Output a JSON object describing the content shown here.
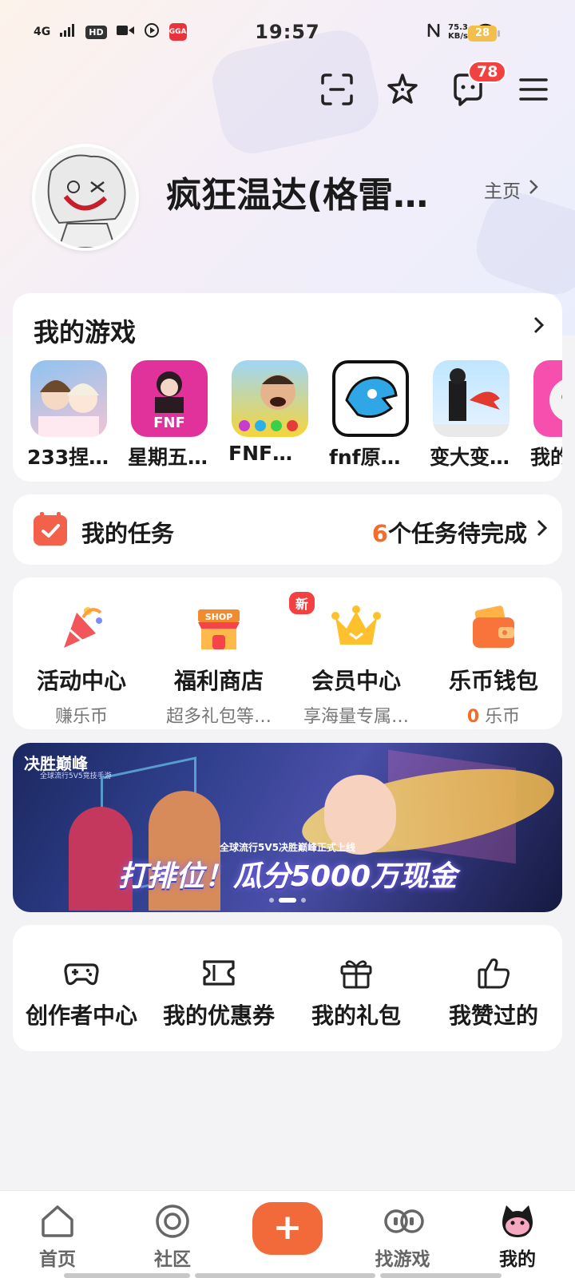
{
  "status_bar": {
    "signal": "4G",
    "hd": "HD",
    "app_badge": "GGA",
    "time": "19:57",
    "net_speed_value": "75.3",
    "net_speed_unit": "KB/s",
    "battery": "28"
  },
  "header": {
    "message_badge": "78"
  },
  "profile": {
    "username": "疯狂温达(格雷…",
    "home_link": "主页"
  },
  "my_games": {
    "title": "我的游戏",
    "games": [
      {
        "name": "233捏…"
      },
      {
        "name": "星期五…"
      },
      {
        "name": "FNF…"
      },
      {
        "name": "fnf原…"
      },
      {
        "name": "变大变…"
      },
      {
        "name": "我的"
      }
    ]
  },
  "tasks": {
    "label": "我的任务",
    "count": "6",
    "status_text": "个任务待完成"
  },
  "features": {
    "items": [
      {
        "title": "活动中心",
        "sub": "赚乐币"
      },
      {
        "title": "福利商店",
        "sub": "超多礼包等…",
        "badge": "新"
      },
      {
        "title": "会员中心",
        "sub": "享海量专属…"
      },
      {
        "title": "乐币钱包",
        "coin": "0",
        "sub": "乐币"
      }
    ]
  },
  "banner": {
    "logo": "决胜巅峰",
    "logo_sub": "全球流行5V5竞技手游",
    "subtitle": "全球流行5V5决胜巅峰正式上线",
    "slogan": "打排位！瓜分5000万现金"
  },
  "tools": {
    "items": [
      {
        "label": "创作者中心"
      },
      {
        "label": "我的优惠券"
      },
      {
        "label": "我的礼包"
      },
      {
        "label": "我赞过的"
      }
    ]
  },
  "bottom_nav": {
    "items": [
      {
        "label": "首页"
      },
      {
        "label": "社区"
      },
      {
        "label": "+"
      },
      {
        "label": "找游戏"
      },
      {
        "label": "我的"
      }
    ],
    "active": "我的"
  },
  "colors": {
    "accent": "#f26a3a",
    "badge_red": "#f2413f",
    "coin_orange": "#f26c2c"
  }
}
